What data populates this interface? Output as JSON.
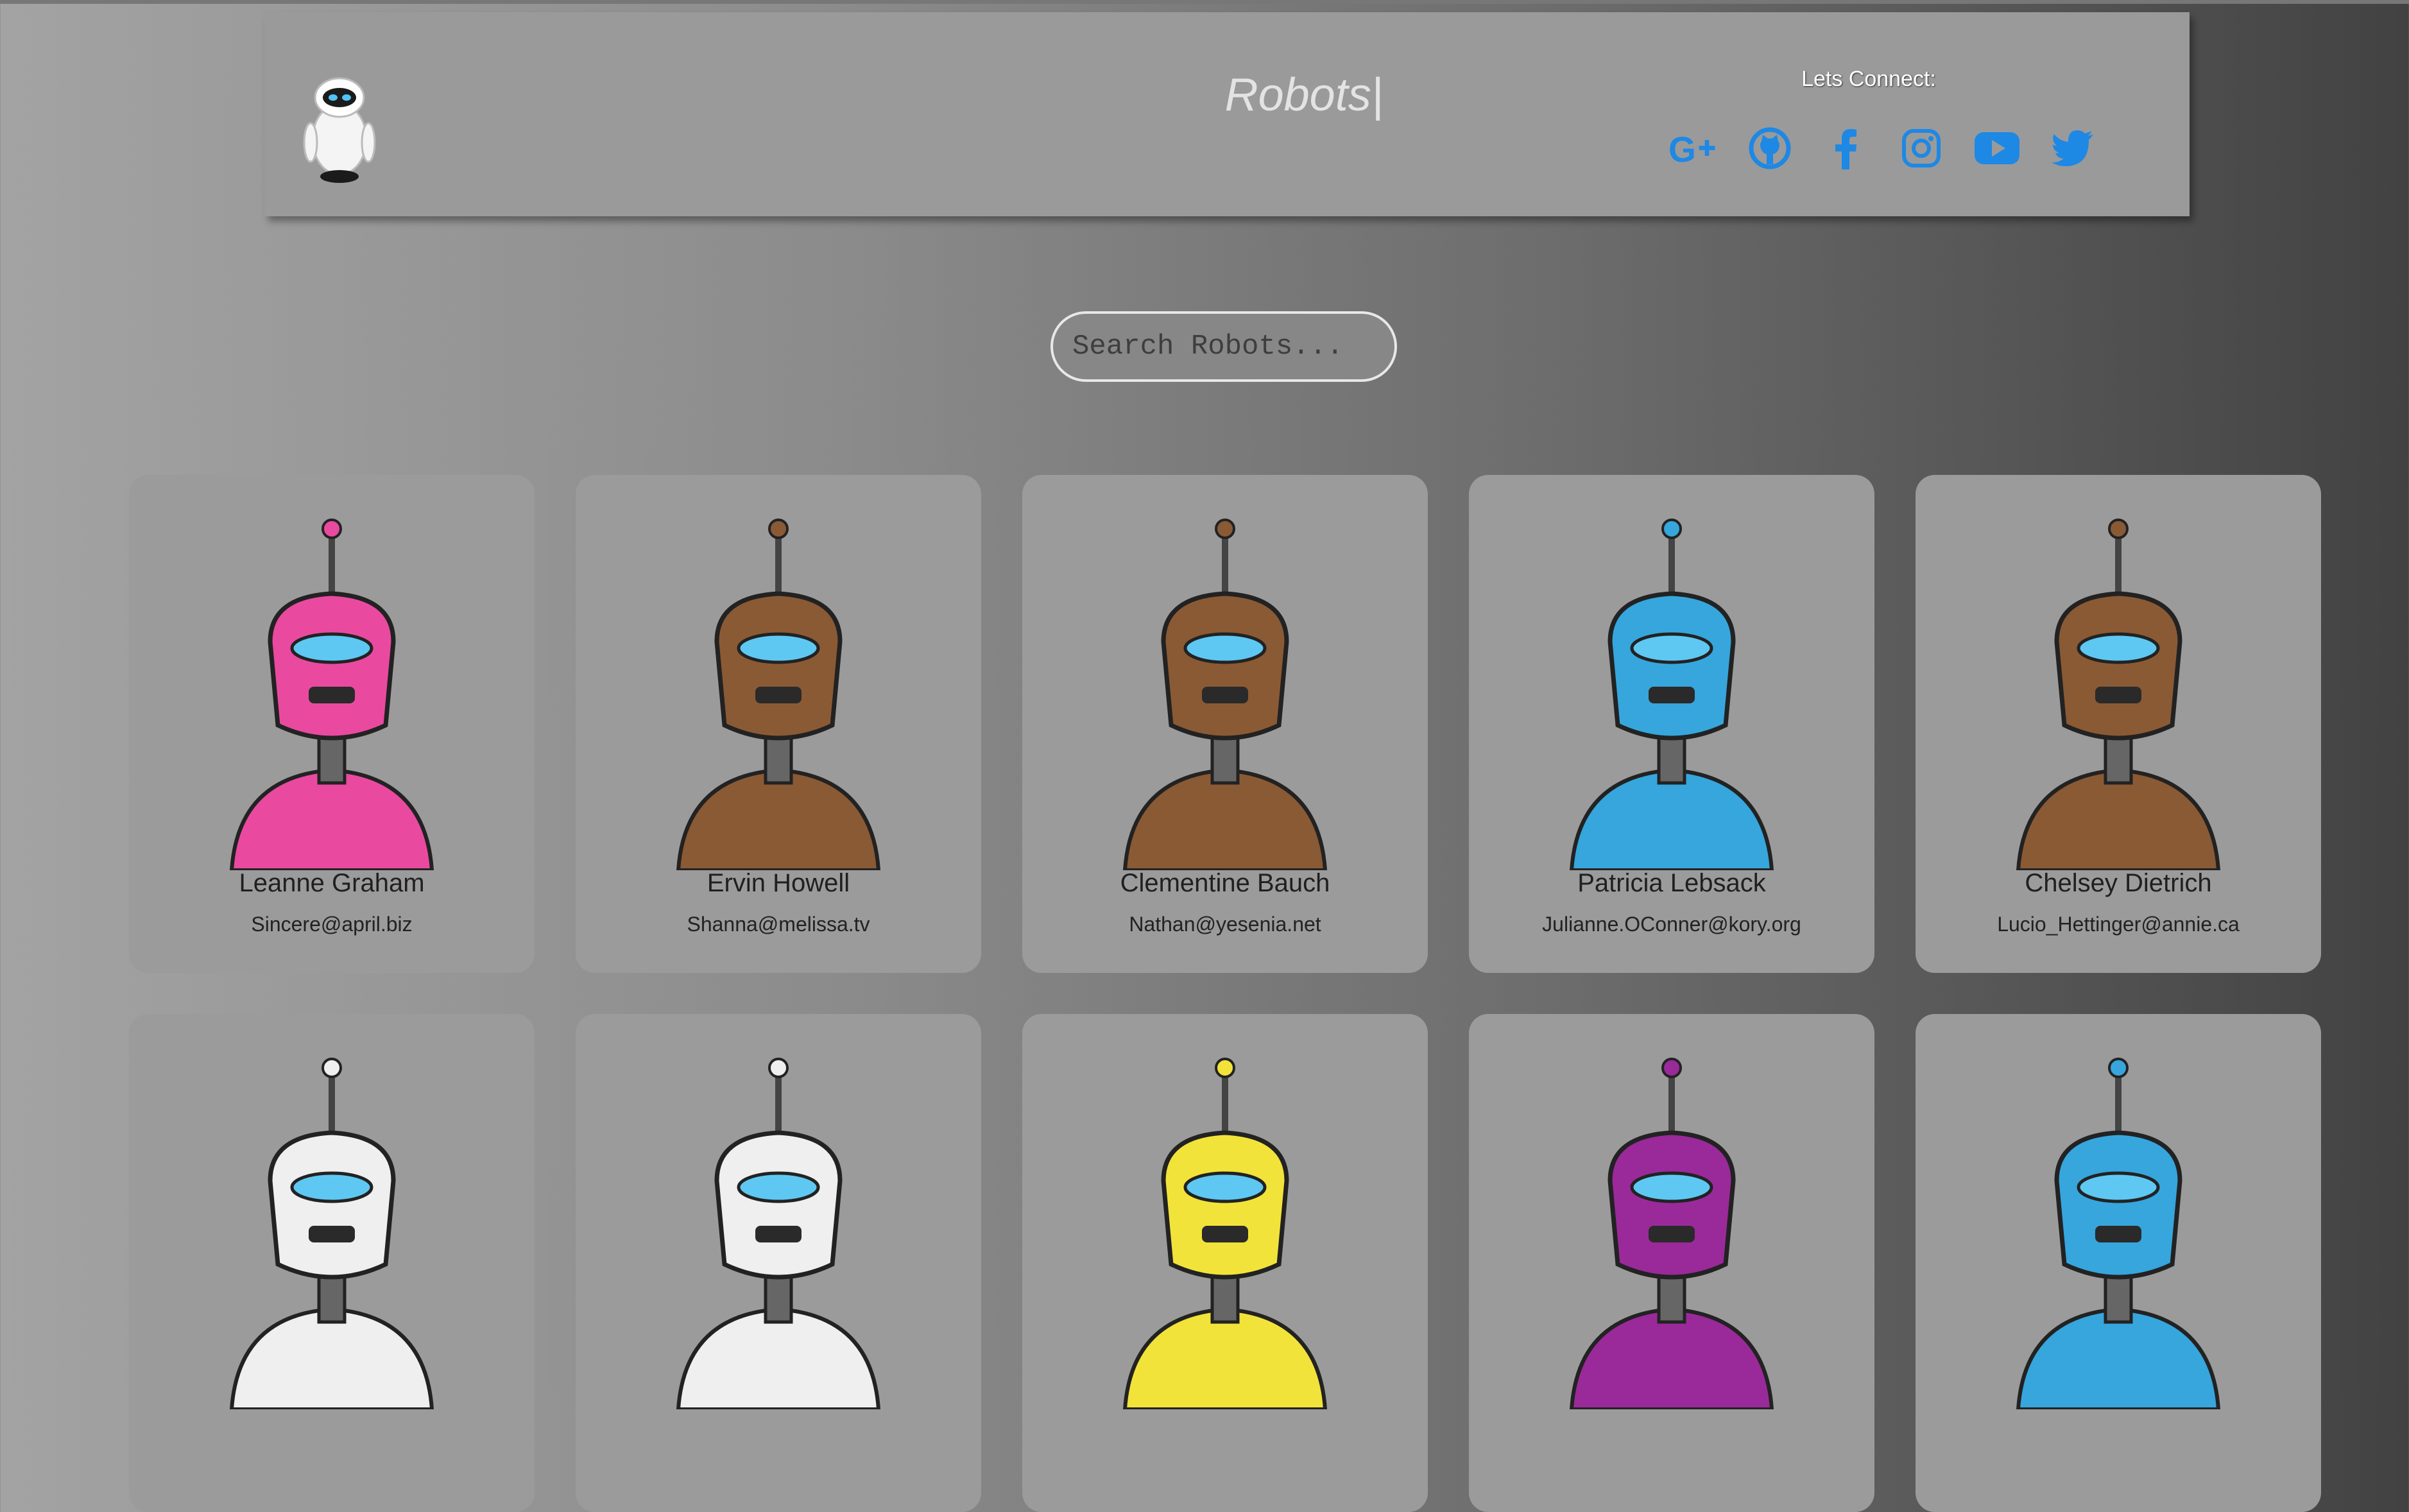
{
  "header": {
    "brand": "Robots|",
    "connect_label": "Lets Connect:",
    "socials": [
      "google-plus-icon",
      "github-icon",
      "facebook-icon",
      "instagram-icon",
      "youtube-icon",
      "twitter-icon"
    ],
    "social_color": "#1e88e5"
  },
  "search": {
    "placeholder": "Search Robots..."
  },
  "robots": [
    {
      "name": "Leanne Graham",
      "email": "Sincere@april.biz",
      "color": "#e94aa0"
    },
    {
      "name": "Ervin Howell",
      "email": "Shanna@melissa.tv",
      "color": "#8a5a35"
    },
    {
      "name": "Clementine Bauch",
      "email": "Nathan@yesenia.net",
      "color": "#8a5a35"
    },
    {
      "name": "Patricia Lebsack",
      "email": "Julianne.OConner@kory.org",
      "color": "#36a6dd"
    },
    {
      "name": "Chelsey Dietrich",
      "email": "Lucio_Hettinger@annie.ca",
      "color": "#8a5a35"
    },
    {
      "name": "",
      "email": "",
      "color": "#efefef"
    },
    {
      "name": "",
      "email": "",
      "color": "#efefef"
    },
    {
      "name": "",
      "email": "",
      "color": "#f2e33a"
    },
    {
      "name": "",
      "email": "",
      "color": "#9a2a9a"
    },
    {
      "name": "",
      "email": "",
      "color": "#36a6dd"
    }
  ]
}
